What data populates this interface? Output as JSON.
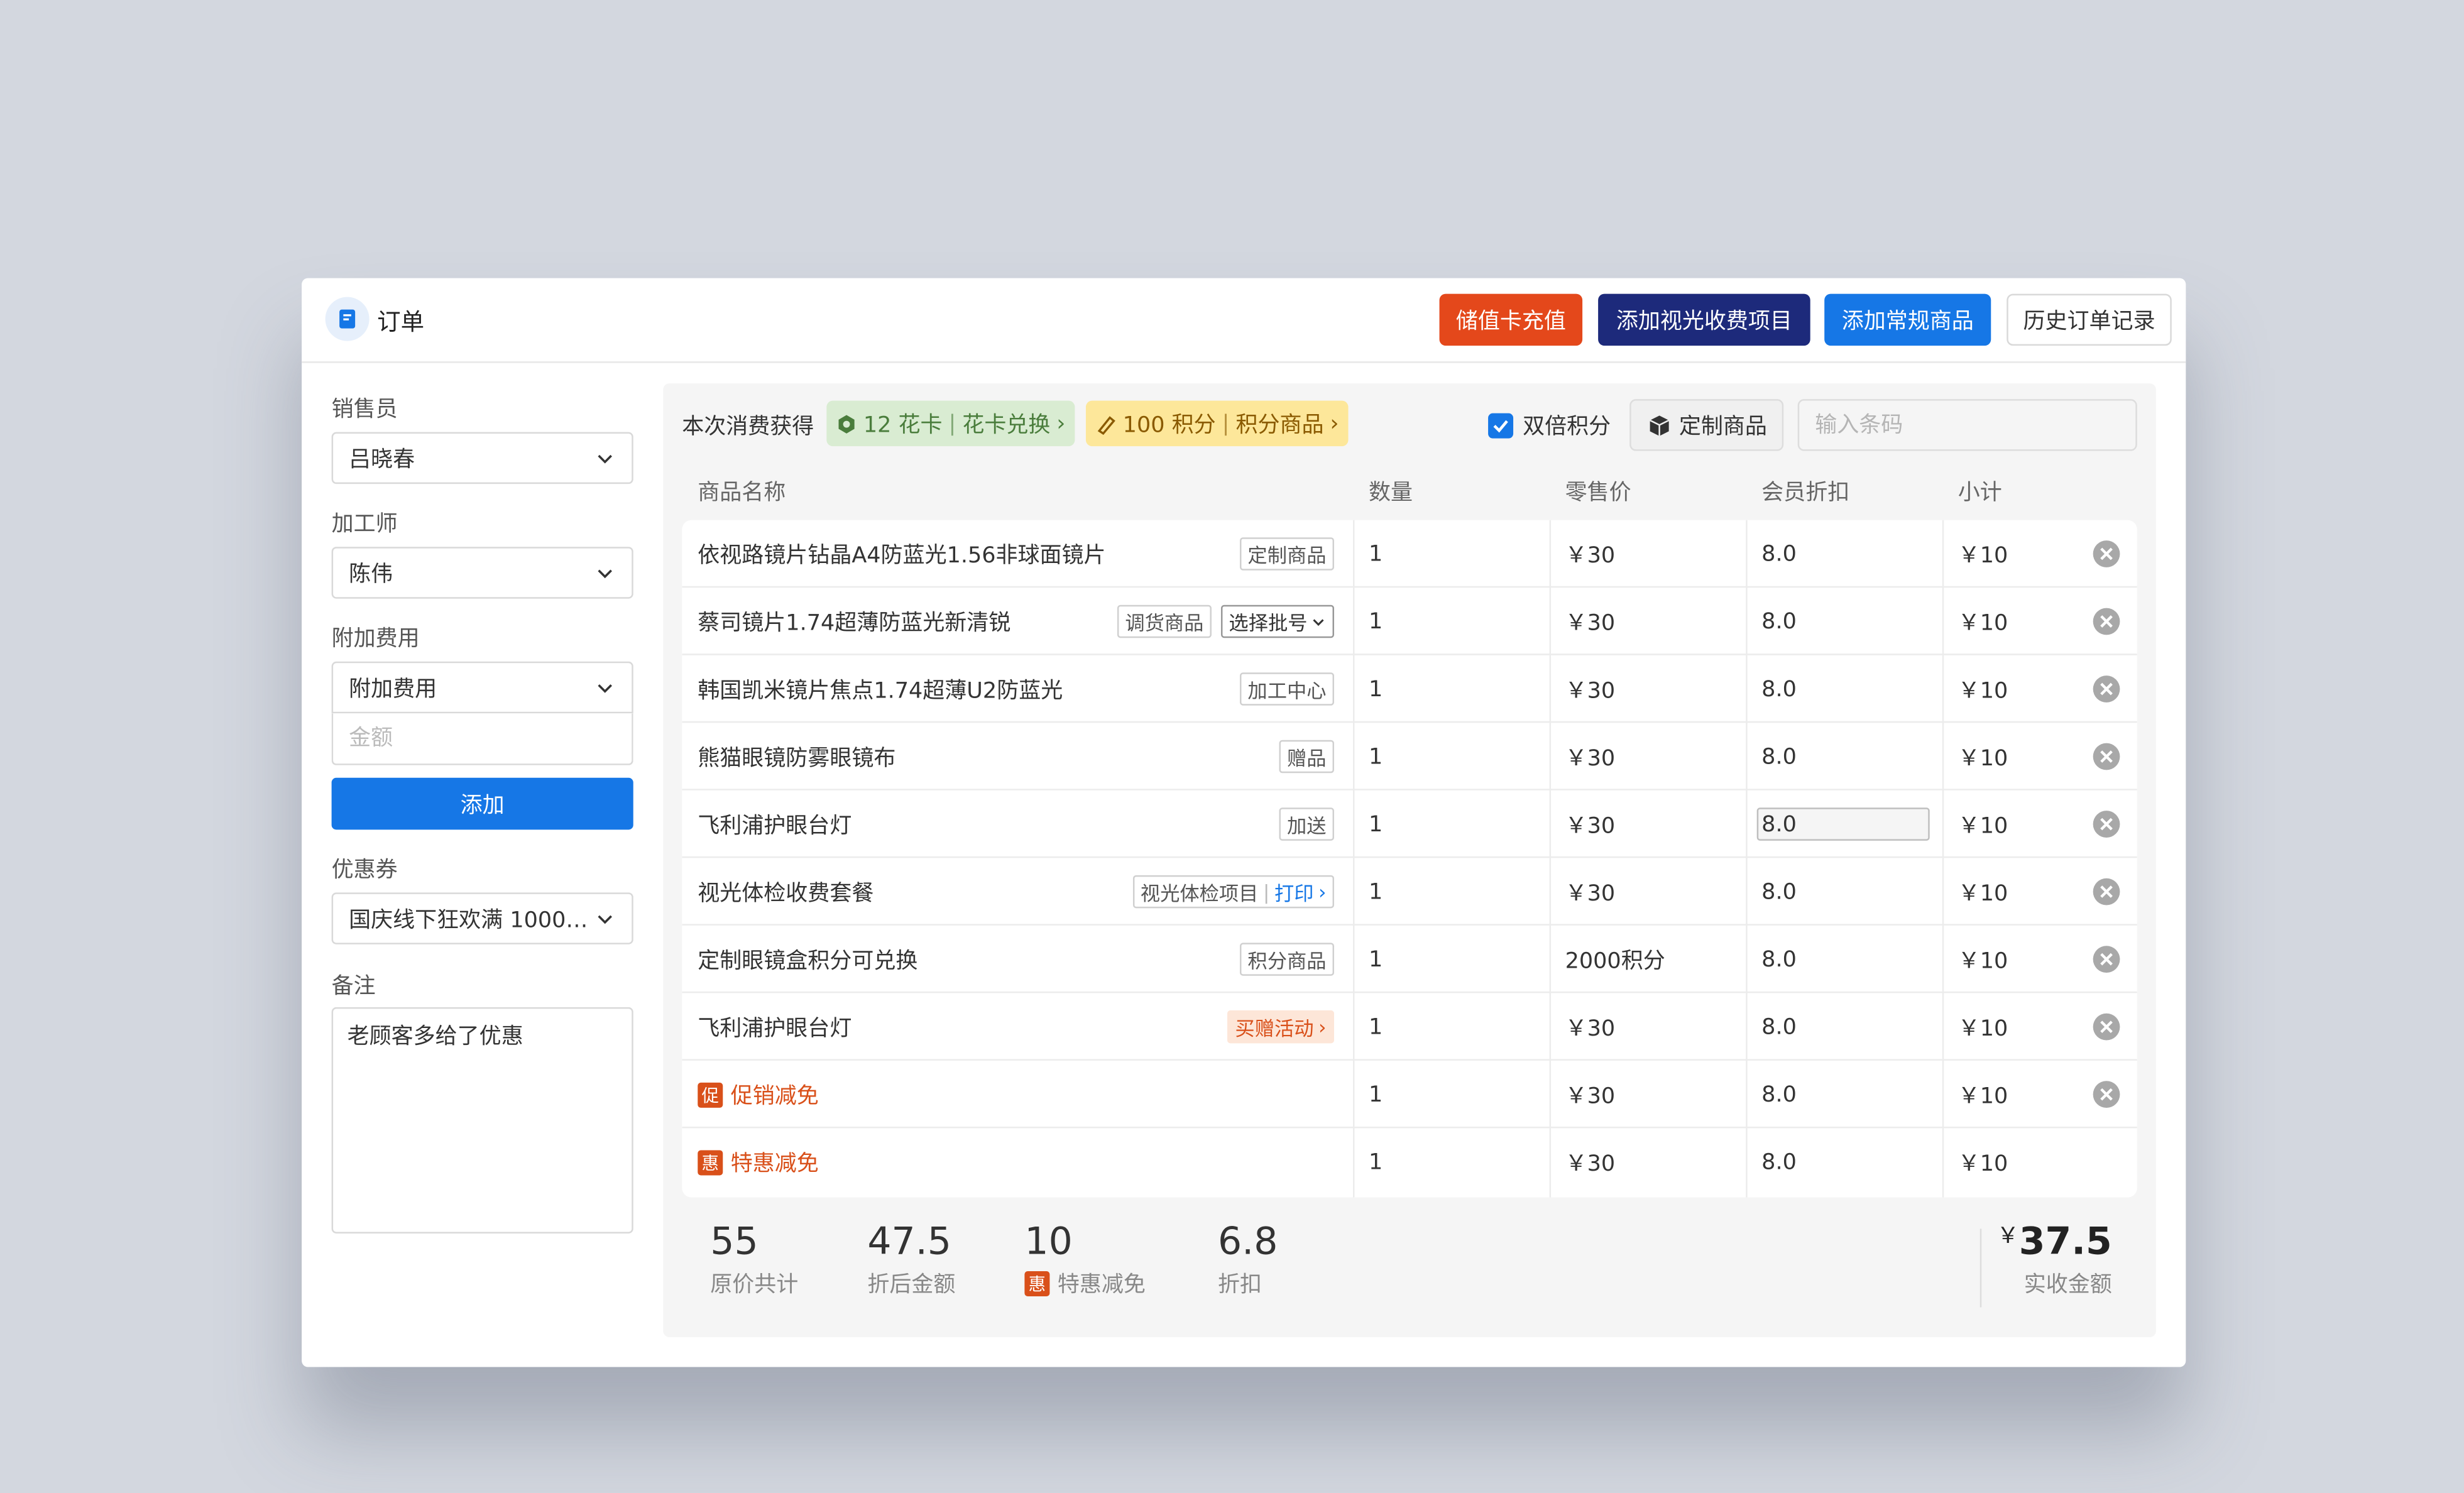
{
  "header": {
    "title": "订单",
    "buttons": {
      "recharge": "储值卡充值",
      "add_vision_fee": "添加视光收费项目",
      "add_regular": "添加常规商品",
      "history": "历史订单记录"
    }
  },
  "sidebar": {
    "salesperson": {
      "label": "销售员",
      "value": "吕晓春"
    },
    "processor": {
      "label": "加工师",
      "value": "陈伟"
    },
    "extra_fee": {
      "label": "附加费用",
      "value": "附加费用",
      "amount_placeholder": "金额",
      "add_button": "添加"
    },
    "coupon": {
      "label": "优惠券",
      "value": "国庆线下狂欢满 1000…"
    },
    "remark": {
      "label": "备注",
      "value": "老顾客多给了优惠"
    }
  },
  "earn": {
    "label": "本次消费获得",
    "flower_card": {
      "count": "12 花卡",
      "action": "花卡兑换"
    },
    "points": {
      "count": "100 积分",
      "action": "积分商品"
    },
    "double_points": "双倍积分",
    "custom_goods": "定制商品",
    "barcode_placeholder": "输入条码"
  },
  "columns": [
    "商品名称",
    "数量",
    "零售价",
    "会员折扣",
    "小计"
  ],
  "rows": [
    {
      "name": "依视路镜片钻晶A4防蓝光1.56非球面镜片",
      "tags": [
        "定制商品"
      ],
      "qty": "1",
      "price": "￥30",
      "discount": "8.0",
      "subtotal": "￥10"
    },
    {
      "name": "蔡司镜片1.74超薄防蓝光新清锐",
      "tags": [
        "调货商品",
        "选择批号"
      ],
      "qty": "1",
      "price": "￥30",
      "discount": "8.0",
      "subtotal": "￥10"
    },
    {
      "name": "韩国凯米镜片焦点1.74超薄U2防蓝光",
      "tags": [
        "加工中心"
      ],
      "qty": "1",
      "price": "￥30",
      "discount": "8.0",
      "subtotal": "￥10"
    },
    {
      "name": "熊猫眼镜防雾眼镜布",
      "tags": [
        "赠品"
      ],
      "qty": "1",
      "price": "￥30",
      "discount": "8.0",
      "subtotal": "￥10"
    },
    {
      "name": "飞利浦护眼台灯",
      "tags": [
        "加送"
      ],
      "qty": "1",
      "price": "￥30",
      "discount": "8.0",
      "subtotal": "￥10"
    },
    {
      "name": "视光体检收费套餐",
      "tags": [
        "视光体检项目",
        "打印"
      ],
      "qty": "1",
      "price": "￥30",
      "discount": "8.0",
      "subtotal": "￥10"
    },
    {
      "name": "定制眼镜盒积分可兑换",
      "tags": [
        "积分商品"
      ],
      "qty": "1",
      "price": "2000积分",
      "discount": "8.0",
      "subtotal": "￥10"
    },
    {
      "name": "飞利浦护眼台灯",
      "tags": [
        "买赠活动"
      ],
      "qty": "1",
      "price": "￥30",
      "discount": "8.0",
      "subtotal": "￥10"
    },
    {
      "name": "促销减免",
      "icon_char": "促",
      "qty": "1",
      "price": "￥30",
      "discount": "8.0",
      "subtotal": "￥10"
    },
    {
      "name": "特惠减免",
      "icon_char": "惠",
      "qty": "1",
      "price": "￥30",
      "discount": "8.0",
      "subtotal": "￥10"
    }
  ],
  "totals": {
    "original": {
      "value": "55",
      "label": "原价共计"
    },
    "discounted": {
      "value": "47.5",
      "label": "折后金额"
    },
    "special": {
      "value": "10",
      "label": "特惠减免",
      "icon_char": "惠"
    },
    "discount_rate": {
      "value": "6.8",
      "label": "折扣"
    },
    "final": {
      "currency": "￥",
      "value": "37.5",
      "label": "实收金额"
    }
  },
  "colors": {
    "primary": "#1677e6",
    "danger": "#e4481b",
    "navy": "#1d2a7b",
    "promo": "#d9501a"
  }
}
